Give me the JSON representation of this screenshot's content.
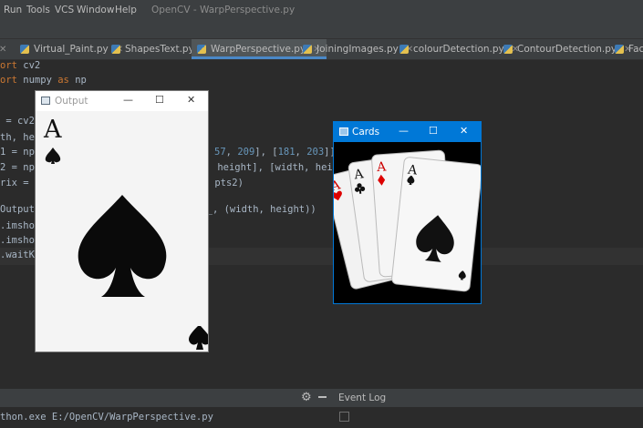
{
  "menu": {
    "items": [
      "Run",
      "Tools",
      "VCS",
      "Window",
      "Help"
    ],
    "title": "OpenCV - WarpPerspective.py"
  },
  "tabs": [
    "Virtual_Paint.py",
    "ShapesText.py",
    "WarpPerspective.py",
    "JoiningImages.py",
    "colourDetection.py",
    "ContourDetection.py",
    "Face"
  ],
  "code": {
    "l1_kw": "ort",
    "l1_rest": " cv2",
    "l2_kw": "ort",
    "l2_rest": " numpy ",
    "l2_as": "as",
    "l2_np": " np",
    "l5": " = cv2.",
    "l6": "th, hei",
    "l7_a": "1 = np.",
    "l7_n1": "57",
    "l7_b": ", ",
    "l7_n2": "209",
    "l7_c": "], [",
    "l7_n3": "181",
    "l7_d": ", ",
    "l7_n4": "203",
    "l7_e": "]])",
    "l8_a": "2 = np.",
    "l8_b": " height], [width, heig",
    "l9_a": "rix = c",
    "l9_b": " pts2)",
    "l11_a": "Output ",
    "l11_b": "ix_, (width, height))",
    "l12": ".imshow",
    "l13": ".imshow",
    "l14": ".waitKe"
  },
  "bottom": {
    "run_text": "thon.exe E:/OpenCV/WarpPerspective.py",
    "event_log": "Event Log"
  },
  "windows": {
    "output_title": "Output",
    "cards_title": "Cards",
    "minimize": "—",
    "maximize": "☐",
    "close": "✕"
  },
  "card": {
    "rank": "A"
  },
  "icons": [
    "gear-icon",
    "minimize-icon",
    "checkbox-icon",
    "window-app-icon",
    "python-file-icon",
    "spade-icon",
    "heart-icon",
    "club-icon",
    "diamond-icon"
  ],
  "colors": {
    "ide_bg": "#2b2b2b",
    "chrome": "#3c3f41",
    "keyword": "#cc7832",
    "number": "#6897bb",
    "win_accent": "#0078d7"
  }
}
